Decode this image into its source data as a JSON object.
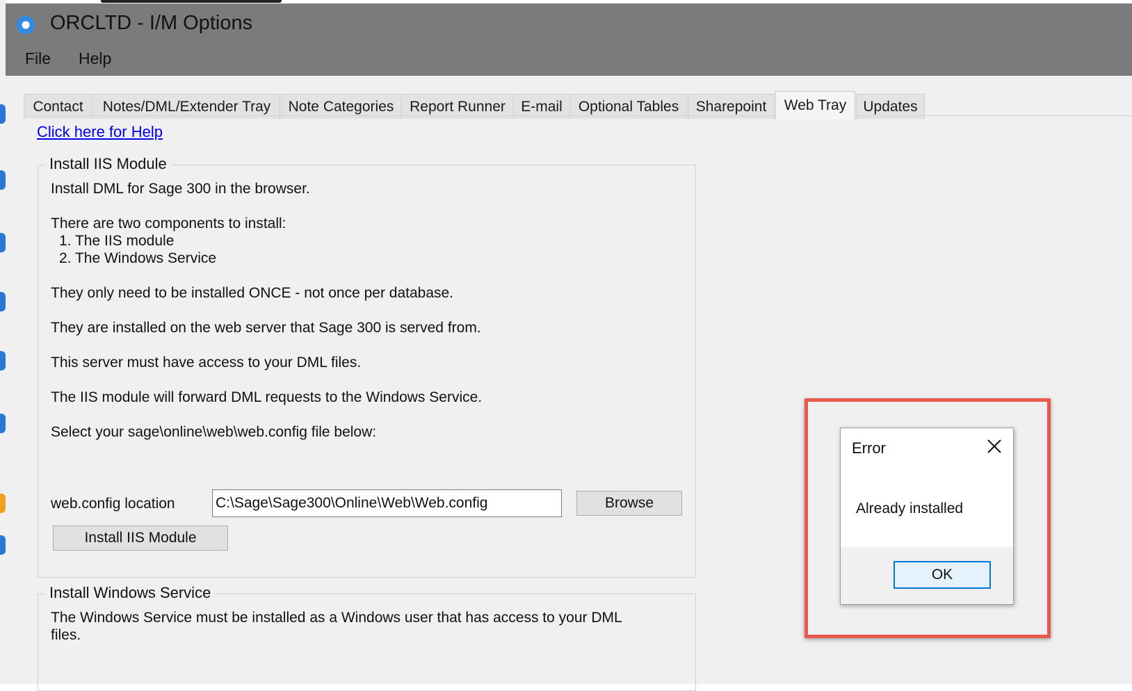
{
  "window": {
    "title": "ORCLTD - I/M Options",
    "menu": [
      "File",
      "Help"
    ]
  },
  "tabs": [
    {
      "label": "Contact"
    },
    {
      "label": "Notes/DML/Extender Tray"
    },
    {
      "label": "Note Categories"
    },
    {
      "label": "Report Runner"
    },
    {
      "label": "E-mail"
    },
    {
      "label": "Optional Tables"
    },
    {
      "label": "Sharepoint"
    },
    {
      "label": "Web Tray",
      "active": true
    },
    {
      "label": "Updates"
    }
  ],
  "help_link": "Click here for Help",
  "iis_group": {
    "title": "Install IIS Module",
    "lines": [
      "Install DML for Sage 300 in the browser.",
      "There are two components to install:",
      "1. The IIS module",
      "2. The Windows Service",
      "They only need to be installed ONCE - not once per database.",
      "They are installed on the web server that Sage 300 is served from.",
      "This server must have access to your DML files.",
      "The IIS module will forward DML requests to the Windows Service.",
      "Select your sage\\online\\web\\web.config file below:"
    ],
    "config_label": "web.config location",
    "config_value": "C:\\Sage\\Sage300\\Online\\Web\\Web.config",
    "browse_label": "Browse",
    "install_label": "Install IIS Module"
  },
  "service_group": {
    "title": "Install Windows Service",
    "lines": [
      "The Windows Service must be installed as a Windows user that has access to your DML",
      "files."
    ]
  },
  "dialog": {
    "title": "Error",
    "message": "Already installed",
    "ok_label": "OK",
    "close_icon": "close-icon"
  },
  "colors": {
    "titlebar": "#7b7b7b",
    "highlight": "#e8584d",
    "link": "#0000ee",
    "ok_border": "#0078d7"
  }
}
